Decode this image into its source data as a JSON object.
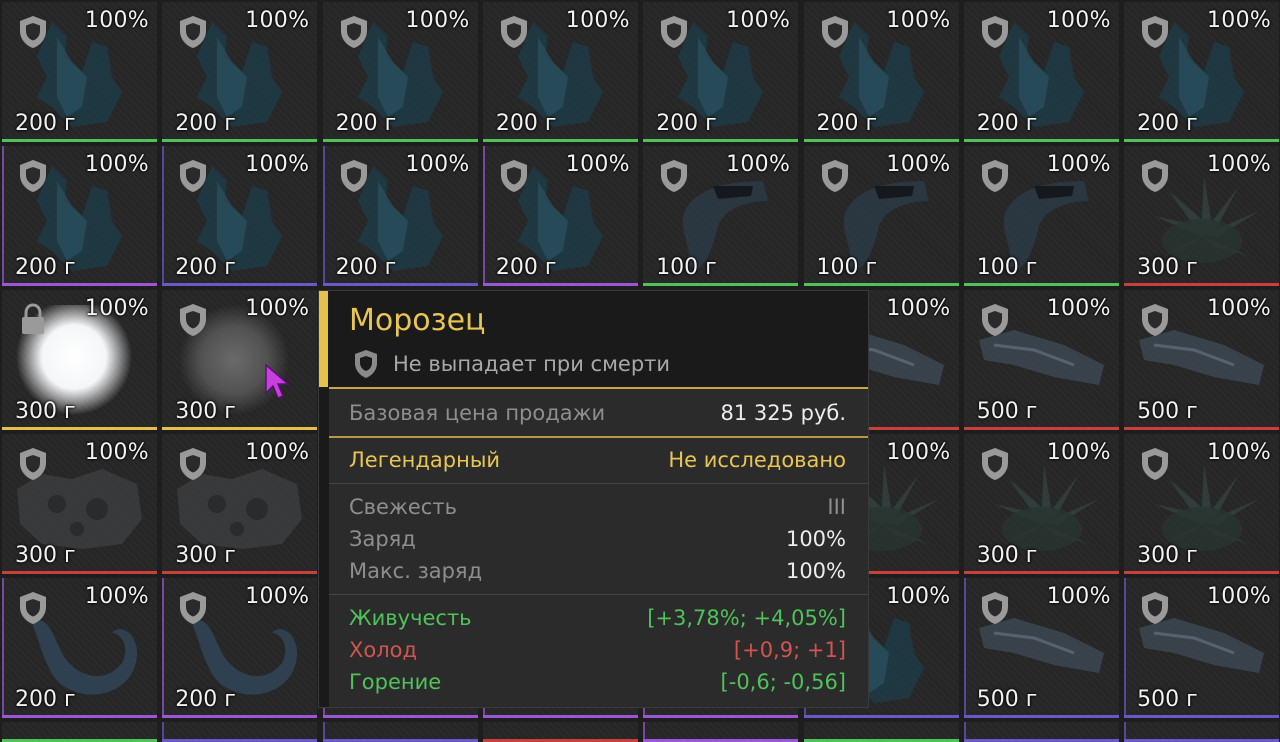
{
  "colors": {
    "green": "#4fc25a",
    "red": "#c8403c",
    "gold": "#e5c04d",
    "purple": "#9a55d8",
    "blue_violet": "#6a58c8"
  },
  "grid": {
    "rows": [
      [
        {
          "pct": "100%",
          "weight": "200 г",
          "badge": "shield-icon",
          "art": "shard",
          "rarity": "green"
        },
        {
          "pct": "100%",
          "weight": "200 г",
          "badge": "shield-icon",
          "art": "shard",
          "rarity": "green"
        },
        {
          "pct": "100%",
          "weight": "200 г",
          "badge": "shield-icon",
          "art": "shard",
          "rarity": "green"
        },
        {
          "pct": "100%",
          "weight": "200 г",
          "badge": "shield-icon",
          "art": "shard",
          "rarity": "green"
        },
        {
          "pct": "100%",
          "weight": "200 г",
          "badge": "shield-icon",
          "art": "shard",
          "rarity": "green"
        },
        {
          "pct": "100%",
          "weight": "200 г",
          "badge": "shield-icon",
          "art": "shard",
          "rarity": "green"
        },
        {
          "pct": "100%",
          "weight": "200 г",
          "badge": "shield-icon",
          "art": "shard",
          "rarity": "green"
        },
        {
          "pct": "100%",
          "weight": "200 г",
          "badge": "shield-icon",
          "art": "shard",
          "rarity": "green"
        }
      ],
      [
        {
          "pct": "100%",
          "weight": "200 г",
          "badge": "shield-icon",
          "art": "shard",
          "rarity": "purple"
        },
        {
          "pct": "100%",
          "weight": "200 г",
          "badge": "shield-icon",
          "art": "shard",
          "rarity": "blue_violet"
        },
        {
          "pct": "100%",
          "weight": "200 г",
          "badge": "shield-icon",
          "art": "shard",
          "rarity": "blue_violet"
        },
        {
          "pct": "100%",
          "weight": "200 г",
          "badge": "shield-icon",
          "art": "shard",
          "rarity": "purple"
        },
        {
          "pct": "100%",
          "weight": "100 г",
          "badge": "shield-icon",
          "art": "claw",
          "rarity": "green"
        },
        {
          "pct": "100%",
          "weight": "100 г",
          "badge": "shield-icon",
          "art": "claw",
          "rarity": "green"
        },
        {
          "pct": "100%",
          "weight": "100 г",
          "badge": "shield-icon",
          "art": "claw",
          "rarity": "green"
        },
        {
          "pct": "100%",
          "weight": "300 г",
          "badge": "shield-icon",
          "art": "crystal",
          "rarity": "red"
        }
      ],
      [
        {
          "pct": "100%",
          "weight": "300 г",
          "badge": "lock-icon",
          "art": "orb-bright",
          "rarity": "gold"
        },
        {
          "pct": "100%",
          "weight": "300 г",
          "badge": "shield-icon",
          "art": "orb-dim",
          "rarity": "gold"
        },
        {
          "pct": "",
          "weight": "",
          "badge": "",
          "art": "",
          "rarity": "gold"
        },
        {
          "pct": "",
          "weight": "",
          "badge": "",
          "art": "",
          "rarity": "gold"
        },
        {
          "pct": "",
          "weight": "",
          "badge": "",
          "art": "",
          "rarity": "gold"
        },
        {
          "pct": "100%",
          "weight": "г",
          "badge": "",
          "art": "slab",
          "rarity": "red"
        },
        {
          "pct": "100%",
          "weight": "500 г",
          "badge": "shield-icon",
          "art": "slab",
          "rarity": "red"
        },
        {
          "pct": "100%",
          "weight": "500 г",
          "badge": "shield-icon",
          "art": "slab",
          "rarity": "red"
        }
      ],
      [
        {
          "pct": "100%",
          "weight": "300 г",
          "badge": "shield-icon",
          "art": "rock",
          "rarity": "red"
        },
        {
          "pct": "100%",
          "weight": "300 г",
          "badge": "shield-icon",
          "art": "rock",
          "rarity": "red"
        },
        {
          "pct": "",
          "weight": "",
          "badge": "",
          "art": "",
          "rarity": "red"
        },
        {
          "pct": "",
          "weight": "",
          "badge": "",
          "art": "",
          "rarity": "red"
        },
        {
          "pct": "",
          "weight": "",
          "badge": "",
          "art": "",
          "rarity": "red"
        },
        {
          "pct": "100%",
          "weight": "г",
          "badge": "",
          "art": "crystal",
          "rarity": "red"
        },
        {
          "pct": "100%",
          "weight": "300 г",
          "badge": "shield-icon",
          "art": "crystal",
          "rarity": "red"
        },
        {
          "pct": "100%",
          "weight": "300 г",
          "badge": "shield-icon",
          "art": "crystal",
          "rarity": "red"
        }
      ],
      [
        {
          "pct": "100%",
          "weight": "200 г",
          "badge": "shield-icon",
          "art": "hook",
          "rarity": "purple"
        },
        {
          "pct": "100%",
          "weight": "200 г",
          "badge": "shield-icon",
          "art": "hook",
          "rarity": "purple"
        },
        {
          "pct": "",
          "weight": "",
          "badge": "",
          "art": "",
          "rarity": "purple"
        },
        {
          "pct": "",
          "weight": "",
          "badge": "",
          "art": "",
          "rarity": "purple"
        },
        {
          "pct": "",
          "weight": "",
          "badge": "",
          "art": "",
          "rarity": "purple"
        },
        {
          "pct": "100%",
          "weight": "",
          "badge": "",
          "art": "shard",
          "rarity": "blue_violet"
        },
        {
          "pct": "100%",
          "weight": "500 г",
          "badge": "shield-icon",
          "art": "slab",
          "rarity": "blue_violet"
        },
        {
          "pct": "100%",
          "weight": "500 г",
          "badge": "shield-icon",
          "art": "slab",
          "rarity": "blue_violet"
        }
      ],
      [
        {
          "pct": "",
          "weight": "",
          "badge": "",
          "art": "",
          "rarity": "green"
        },
        {
          "pct": "",
          "weight": "",
          "badge": "",
          "art": "",
          "rarity": "blue_violet"
        },
        {
          "pct": "",
          "weight": "",
          "badge": "",
          "art": "",
          "rarity": "blue_violet"
        },
        {
          "pct": "",
          "weight": "",
          "badge": "",
          "art": "",
          "rarity": "red"
        },
        {
          "pct": "",
          "weight": "",
          "badge": "",
          "art": "",
          "rarity": "purple"
        },
        {
          "pct": "",
          "weight": "",
          "badge": "",
          "art": "",
          "rarity": "green"
        },
        {
          "pct": "",
          "weight": "",
          "badge": "",
          "art": "",
          "rarity": "blue_violet"
        },
        {
          "pct": "",
          "weight": "",
          "badge": "",
          "art": "",
          "rarity": "blue_violet"
        }
      ]
    ]
  },
  "tooltip": {
    "title": "Морозец",
    "no_drop": "Не выпадает при смерти",
    "base_price_label": "Базовая цена продажи",
    "base_price_value": "81 325 руб.",
    "rarity": "Легендарный",
    "research_status": "Не исследовано",
    "freshness_label": "Свежесть",
    "freshness_value": "III",
    "charge_label": "Заряд",
    "charge_value": "100%",
    "max_charge_label": "Макс. заряд",
    "max_charge_value": "100%",
    "stats": [
      {
        "label": "Живучесть",
        "value": "[+3,78%; +4,05%]",
        "color": "green"
      },
      {
        "label": "Холод",
        "value": "[+0,9; +1]",
        "color": "red"
      },
      {
        "label": "Горение",
        "value": "[-0,6; -0,56]",
        "color": "green"
      }
    ]
  }
}
